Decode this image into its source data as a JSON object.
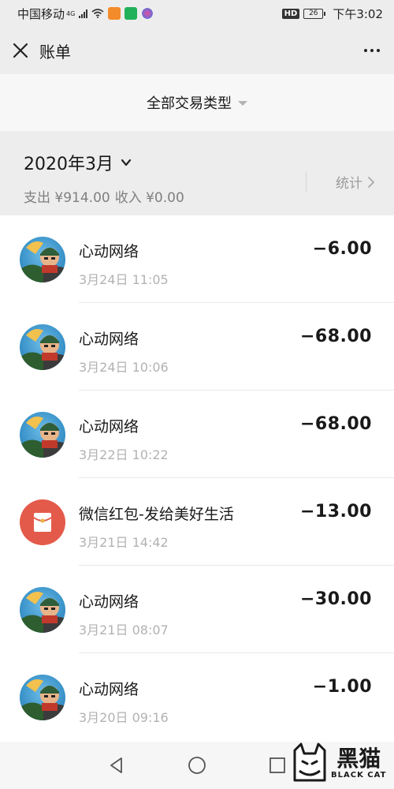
{
  "status_bar": {
    "carrier": "中国移动",
    "network": "4G",
    "hd": "HD",
    "battery": "26",
    "time": "下午3:02"
  },
  "header": {
    "title": "账单",
    "close_icon": "close-icon",
    "more_icon": "more-icon"
  },
  "filter": {
    "label": "全部交易类型"
  },
  "month": {
    "label": "2020年3月",
    "summary_expense": "支出 ¥914.00",
    "summary_income": "收入 ¥0.00",
    "stats_label": "统计"
  },
  "transactions": [
    {
      "name": "心动网络",
      "time": "3月24日 11:05",
      "amount": "−6.00",
      "avatar": "game-avatar"
    },
    {
      "name": "心动网络",
      "time": "3月24日 10:06",
      "amount": "−68.00",
      "avatar": "game-avatar"
    },
    {
      "name": "心动网络",
      "time": "3月22日 10:22",
      "amount": "−68.00",
      "avatar": "game-avatar"
    },
    {
      "name": "微信红包-发给美好生活",
      "time": "3月21日 14:42",
      "amount": "−13.00",
      "avatar": "red-packet-icon"
    },
    {
      "name": "心动网络",
      "time": "3月21日 08:07",
      "amount": "−30.00",
      "avatar": "game-avatar"
    },
    {
      "name": "心动网络",
      "time": "3月20日 09:16",
      "amount": "−1.00",
      "avatar": "game-avatar"
    }
  ],
  "watermark": {
    "cn": "黑猫",
    "en": "BLACK CAT"
  },
  "colors": {
    "background": "#ededed",
    "list_bg": "#ffffff",
    "red_packet": "#e45a4a",
    "secondary_text": "#b2b2b2"
  }
}
